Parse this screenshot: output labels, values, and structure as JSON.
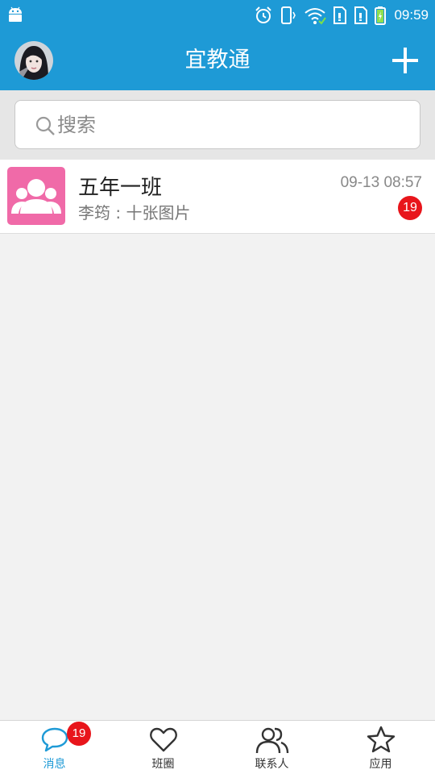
{
  "status_bar": {
    "time": "09:59"
  },
  "header": {
    "title": "宜教通",
    "add_icon": "plus-icon"
  },
  "search": {
    "placeholder": "搜索"
  },
  "conversations": [
    {
      "name": "五年一班",
      "preview": "李筠 : 十张图片",
      "time": "09-13 08:57",
      "unread": "19",
      "icon": "group-icon"
    }
  ],
  "tabs": [
    {
      "label": "消息",
      "icon": "chat-bubble-icon",
      "badge": "19",
      "active": true
    },
    {
      "label": "班圈",
      "icon": "heart-icon",
      "active": false
    },
    {
      "label": "联系人",
      "icon": "contacts-icon",
      "active": false
    },
    {
      "label": "应用",
      "icon": "star-icon",
      "active": false
    }
  ],
  "colors": {
    "primary": "#1e9ad6",
    "badge": "#e8151b",
    "group_avatar": "#f06aa8"
  }
}
